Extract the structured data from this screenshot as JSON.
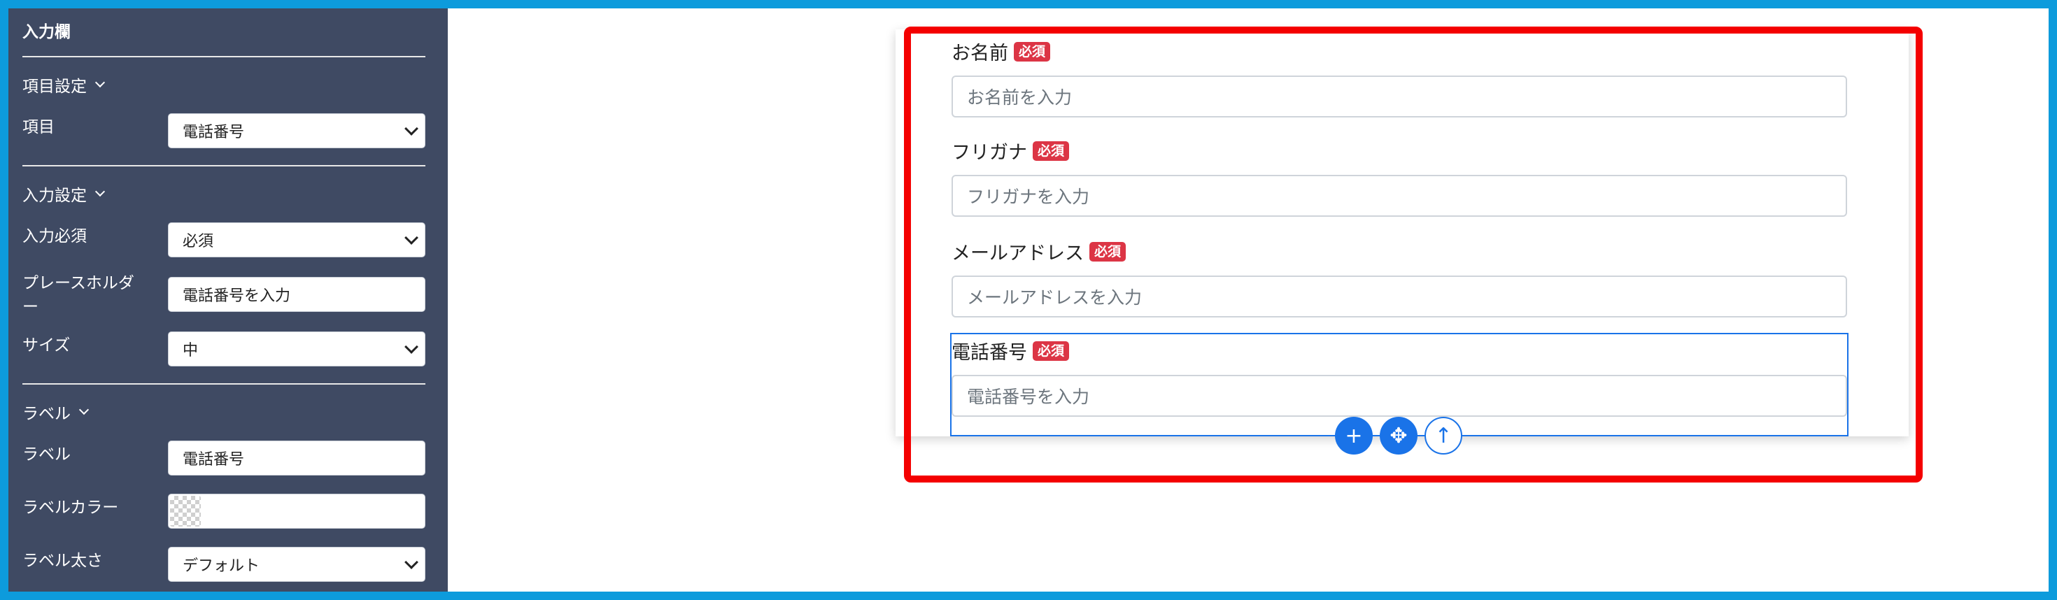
{
  "sidebar": {
    "title": "入力欄",
    "sections": {
      "item_settings": "項目設定",
      "input_settings": "入力設定",
      "label": "ラベル"
    },
    "fields": {
      "item": {
        "label": "項目",
        "value": "電話番号"
      },
      "required": {
        "label": "入力必須",
        "value": "必須"
      },
      "placeholder": {
        "label": "プレースホルダー",
        "value": "電話番号を入力"
      },
      "size": {
        "label": "サイズ",
        "value": "中"
      },
      "label_text": {
        "label": "ラベル",
        "value": "電話番号"
      },
      "label_color": {
        "label": "ラベルカラー",
        "value": ""
      },
      "label_weight": {
        "label": "ラベル太さ",
        "value": "デフォルト"
      }
    }
  },
  "form": {
    "required_badge": "必須",
    "fields": [
      {
        "label": "お名前",
        "placeholder": "お名前を入力"
      },
      {
        "label": "フリガナ",
        "placeholder": "フリガナを入力"
      },
      {
        "label": "メールアドレス",
        "placeholder": "メールアドレスを入力"
      },
      {
        "label": "電話番号",
        "placeholder": "電話番号を入力"
      }
    ],
    "toolbar": {
      "add_icon": "+",
      "move_icon": "✥",
      "up_icon": "↑"
    }
  },
  "colors": {
    "sidebar_bg": "#3f4a63",
    "accent_blue": "#1a73e8",
    "badge_red": "#dc3545",
    "highlight_red": "#f40000",
    "outer_border": "#0d9bdc"
  }
}
